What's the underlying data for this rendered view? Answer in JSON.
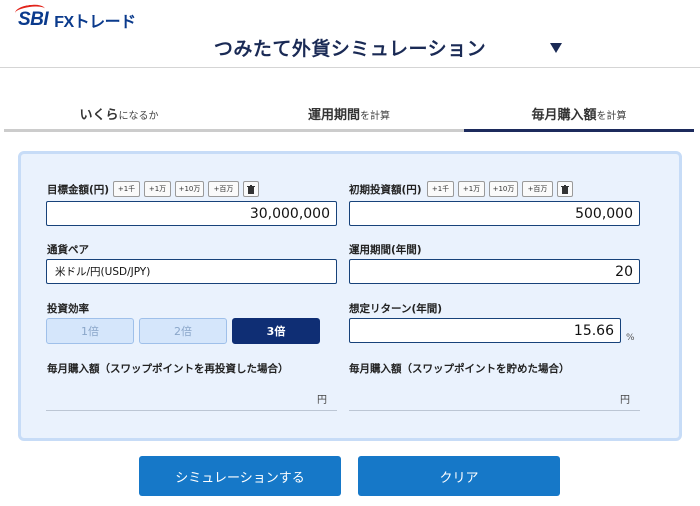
{
  "header": {
    "logo_sbi": "SBI",
    "logo_fx": "FXトレード",
    "title": "つみたて外貨シミュレーション"
  },
  "tabs": [
    {
      "main": "いくら",
      "sub": "になるか"
    },
    {
      "main": "運用期間",
      "sub": "を計算"
    },
    {
      "main": "毎月購入額",
      "sub": "を計算",
      "active": true
    }
  ],
  "form": {
    "target": {
      "label": "目標金額(円)",
      "chips": [
        "+1千",
        "+1万",
        "+10万",
        "+百万"
      ],
      "value": "30,000,000"
    },
    "initial": {
      "label": "初期投資額(円)",
      "chips": [
        "+1千",
        "+1万",
        "+10万",
        "+百万"
      ],
      "value": "500,000"
    },
    "currency": {
      "label": "通貨ペア",
      "value": "米ドル/円(USD/JPY)"
    },
    "period": {
      "label": "運用期間(年間)",
      "value": "20"
    },
    "efficiency": {
      "label": "投資効率",
      "options": [
        "1倍",
        "2倍",
        "3倍"
      ],
      "selected": "3倍"
    },
    "return_rate": {
      "label": "想定リターン(年間)",
      "value": "15.66",
      "unit": "%"
    },
    "result_reinvest": {
      "label": "毎月購入額（スワップポイントを再投資した場合）",
      "unit": "円"
    },
    "result_saved": {
      "label": "毎月購入額（スワップポイントを貯めた場合）",
      "unit": "円"
    }
  },
  "actions": {
    "simulate": "シミュレーションする",
    "clear": "クリア"
  },
  "colors": {
    "brand_navy": "#0f2e74",
    "accent_blue": "#1678c8",
    "panel_bg": "#eaf2fd",
    "logo_red": "#e2231a"
  }
}
